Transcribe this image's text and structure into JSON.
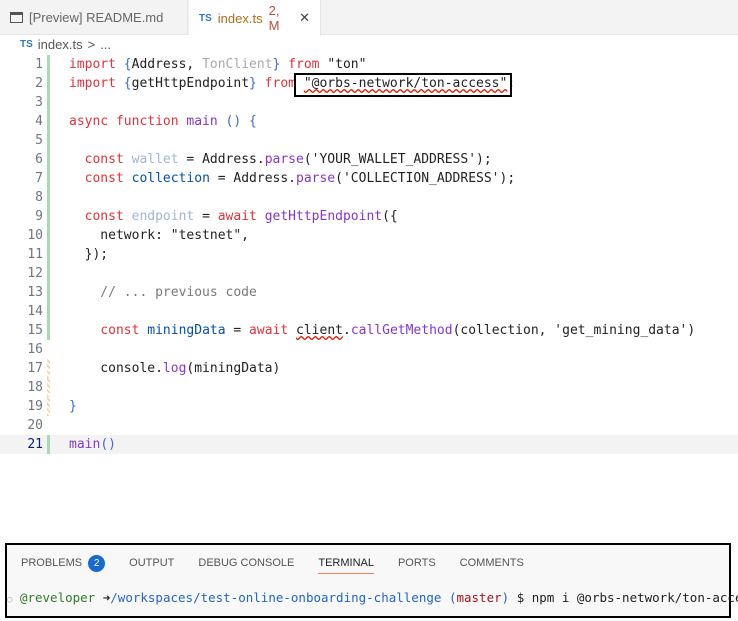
{
  "tabs": [
    {
      "label": "[Preview] README.md",
      "icon": "preview-icon"
    },
    {
      "label": "index.ts",
      "badge": "2, M",
      "icon": "ts-icon",
      "close": "✕"
    }
  ],
  "ts_icon": "TS",
  "breadcrumb": {
    "file": "index.ts",
    "sep": ">",
    "rest": "..."
  },
  "code": [
    [
      [
        "kw",
        "import "
      ],
      [
        "br",
        "{"
      ],
      [
        "pl",
        "Address, "
      ],
      [
        "dim",
        "TonClient"
      ],
      [
        "br",
        "}"
      ],
      [
        "kw",
        " from "
      ],
      [
        "str",
        "\"ton\""
      ]
    ],
    [
      [
        "kw",
        "import "
      ],
      [
        "br",
        "{"
      ],
      [
        "pl",
        "getHttpEndpoint"
      ],
      [
        "br",
        "}"
      ],
      [
        "kw",
        " from "
      ],
      [
        "str sq",
        "\"@orbs-network/ton-access\""
      ],
      [
        "pl",
        ";"
      ]
    ],
    [],
    [
      [
        "kw",
        "async function "
      ],
      [
        "fn",
        "main "
      ],
      [
        "br",
        "() {"
      ]
    ],
    [],
    [
      [
        "pl",
        "  "
      ],
      [
        "kw",
        "const "
      ],
      [
        "un",
        "wallet"
      ],
      [
        "pl",
        " = Address."
      ],
      [
        "fn",
        "parse"
      ],
      [
        "pl",
        "('YOUR_WALLET_ADDRESS');"
      ]
    ],
    [
      [
        "pl",
        "  "
      ],
      [
        "kw",
        "const "
      ],
      [
        "var",
        "collection"
      ],
      [
        "pl",
        " = Address."
      ],
      [
        "fn",
        "parse"
      ],
      [
        "pl",
        "('COLLECTION_ADDRESS');"
      ]
    ],
    [],
    [
      [
        "pl",
        "  "
      ],
      [
        "kw",
        "const "
      ],
      [
        "un",
        "endpoint"
      ],
      [
        "pl",
        " = "
      ],
      [
        "kw",
        "await "
      ],
      [
        "fn",
        "getHttpEndpoint"
      ],
      [
        "pl",
        "({"
      ]
    ],
    [
      [
        "pl",
        "    network: \"testnet\","
      ]
    ],
    [
      [
        "pl",
        "  });"
      ]
    ],
    [],
    [
      [
        "cm",
        "    // ... previous code"
      ]
    ],
    [],
    [
      [
        "pl",
        "    "
      ],
      [
        "kw",
        "const "
      ],
      [
        "var",
        "miningData"
      ],
      [
        "pl",
        " = "
      ],
      [
        "kw",
        "await "
      ],
      [
        "pl sq",
        "client"
      ],
      [
        "pl",
        "."
      ],
      [
        "fn",
        "callGetMethod"
      ],
      [
        "pl",
        "(collection, 'get_mining_data')"
      ]
    ],
    [],
    [
      [
        "pl",
        "    console."
      ],
      [
        "fn",
        "log"
      ],
      [
        "pl",
        "(miningData)"
      ]
    ],
    [],
    [
      [
        "br",
        "}"
      ]
    ],
    [],
    [
      [
        "fn",
        "main"
      ],
      [
        "br",
        "()"
      ]
    ]
  ],
  "gutter": [
    "add",
    "add",
    "add",
    "add",
    "add",
    "add",
    "add",
    "add",
    "add",
    "add",
    "add",
    "add",
    "add",
    "add",
    "add",
    "",
    "mod",
    "mod",
    "mod",
    "",
    "add"
  ],
  "panel": {
    "tabs": [
      "PROBLEMS",
      "OUTPUT",
      "DEBUG CONSOLE",
      "TERMINAL",
      "PORTS",
      "COMMENTS"
    ],
    "problems_count": "2",
    "active": "TERMINAL"
  },
  "terminal": {
    "user": "@reveloper",
    "arrow": "➜",
    "path": "/workspaces/test-online-onboarding-challenge",
    "paren_open": " (",
    "branch": "master",
    "paren_close": ")",
    "command": " $ npm i @orbs-network/ton-access"
  }
}
